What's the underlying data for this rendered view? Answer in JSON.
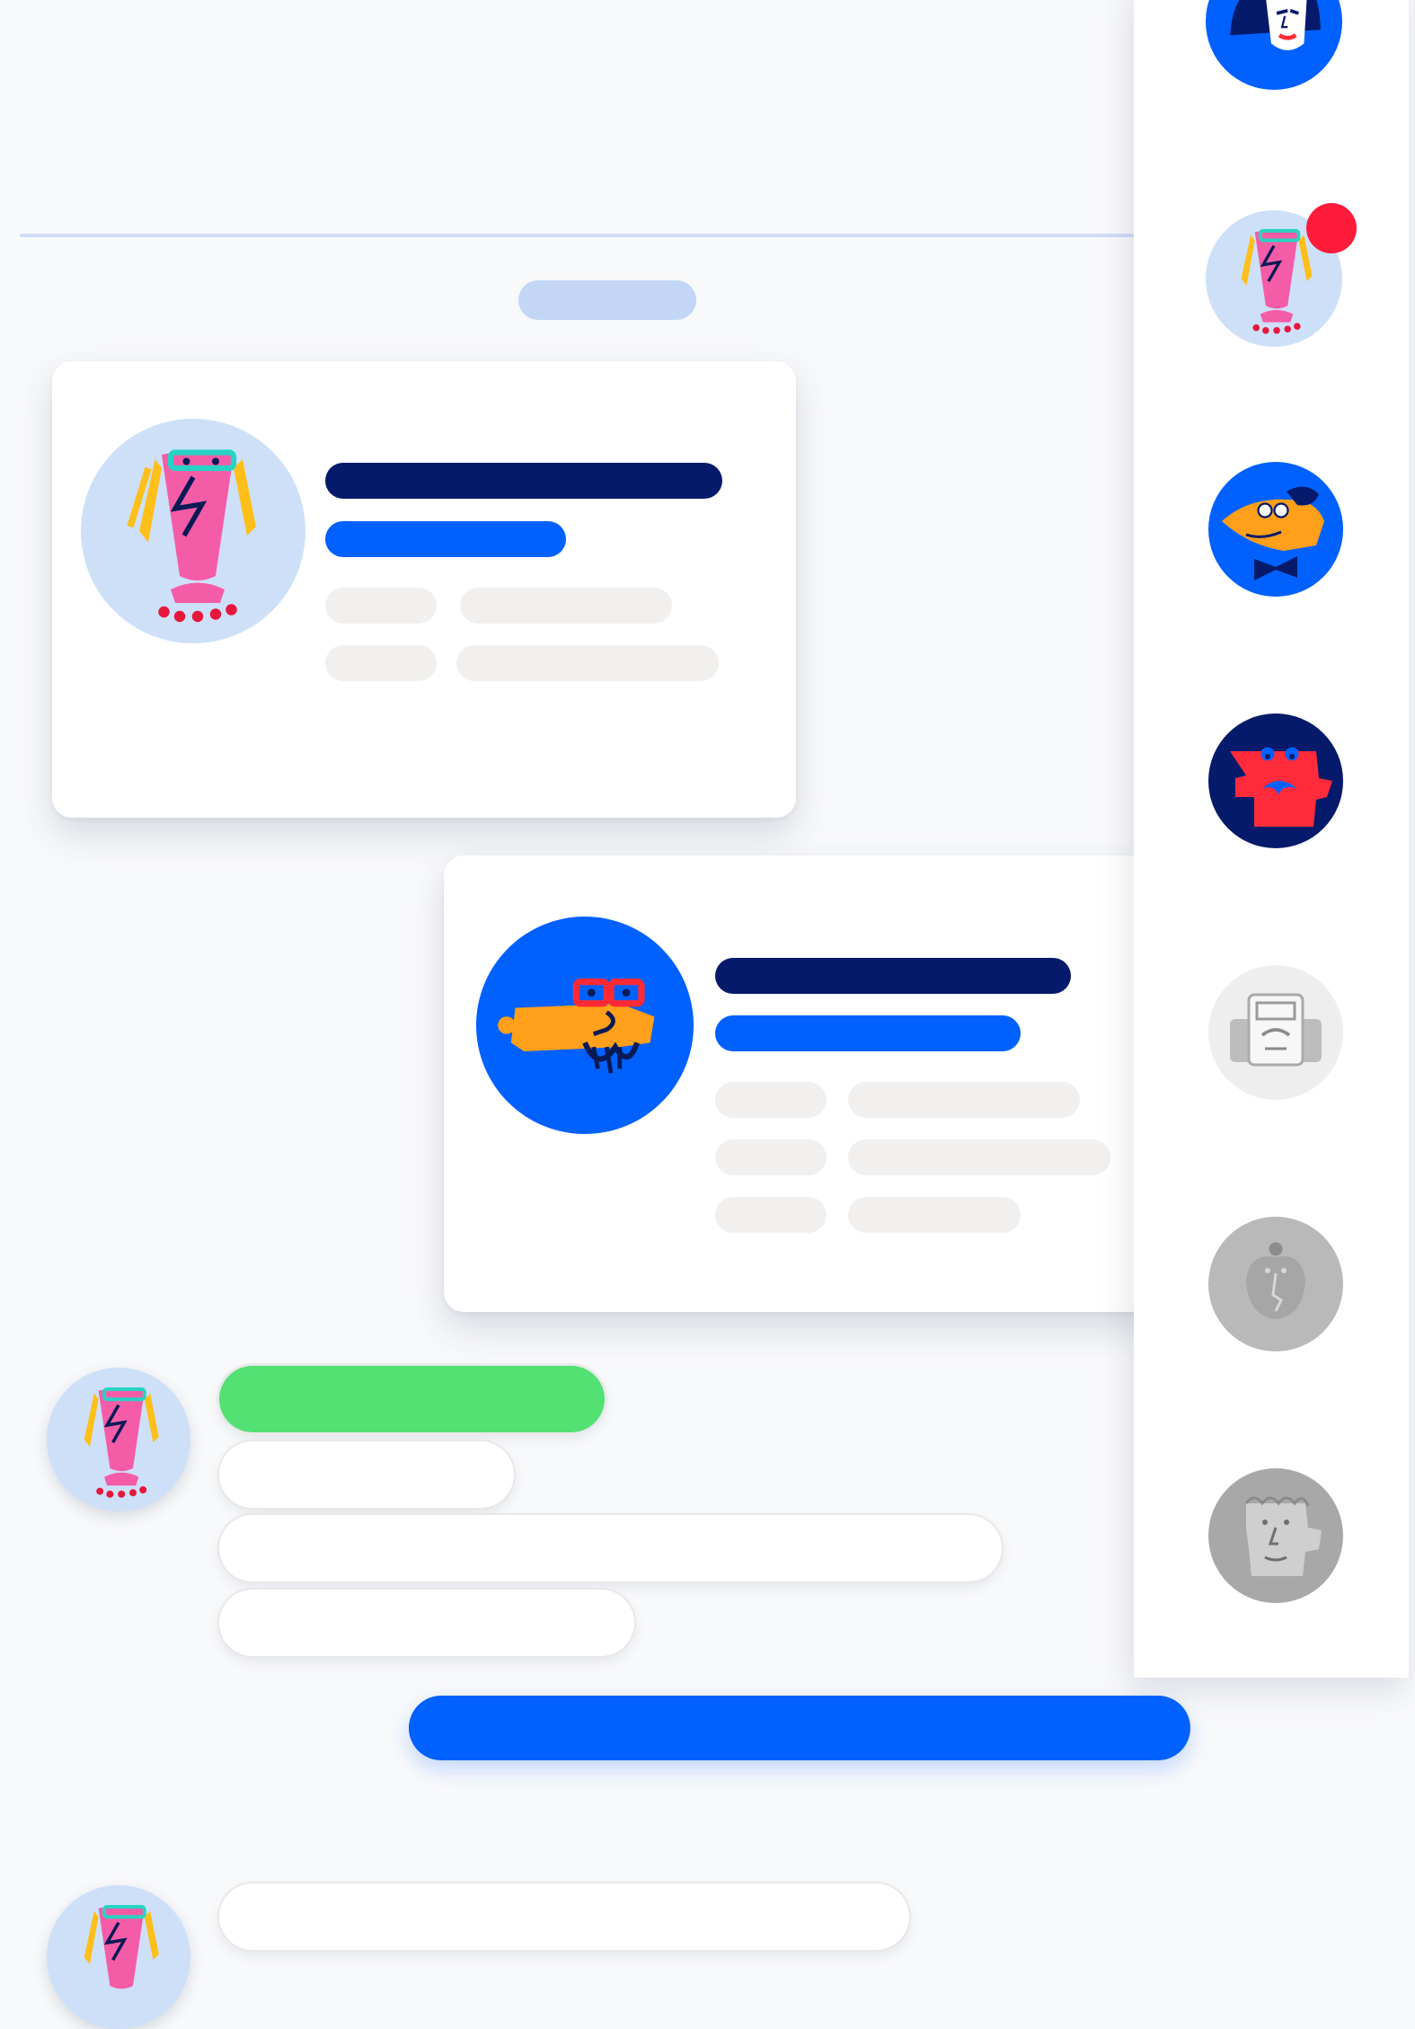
{
  "colors": {
    "background": "#f8f9fb",
    "divider": "#cfdcf5",
    "date_pill": "#c4d6f6",
    "name_bar": "#051a6b",
    "role_bar": "#0061ff",
    "meta_bar": "#f2f0ee",
    "accent_blue": "#0061ff",
    "message_green": "#54e174",
    "notification_red": "#ff1b3a"
  },
  "sidebar": {
    "contacts": [
      {
        "icon": "blue-woman-face-avatar",
        "status": "active"
      },
      {
        "icon": "pink-glasses-face-avatar",
        "status": "unread",
        "badge": true
      },
      {
        "icon": "orange-bowtie-face-avatar",
        "status": "active"
      },
      {
        "icon": "red-mustache-face-avatar",
        "status": "active"
      },
      {
        "icon": "gray-typewriter-face-avatar",
        "status": "inactive"
      },
      {
        "icon": "gray-apple-face-avatar",
        "status": "inactive"
      },
      {
        "icon": "gray-curly-hair-face-avatar",
        "status": "inactive"
      }
    ]
  },
  "cards": [
    {
      "avatar": "pink-glasses-face-avatar",
      "meta_rows": 2
    },
    {
      "avatar": "orange-beard-face-avatar",
      "meta_rows": 3
    }
  ],
  "chat": {
    "messages": [
      {
        "type": "incoming",
        "avatar": "pink-glasses-face-avatar",
        "bubbles": [
          "green",
          "white",
          "white",
          "white"
        ]
      },
      {
        "type": "outgoing",
        "bubbles": [
          "blue"
        ]
      },
      {
        "type": "incoming",
        "avatar": "pink-glasses-face-avatar",
        "bubbles": [
          "white"
        ]
      }
    ]
  }
}
